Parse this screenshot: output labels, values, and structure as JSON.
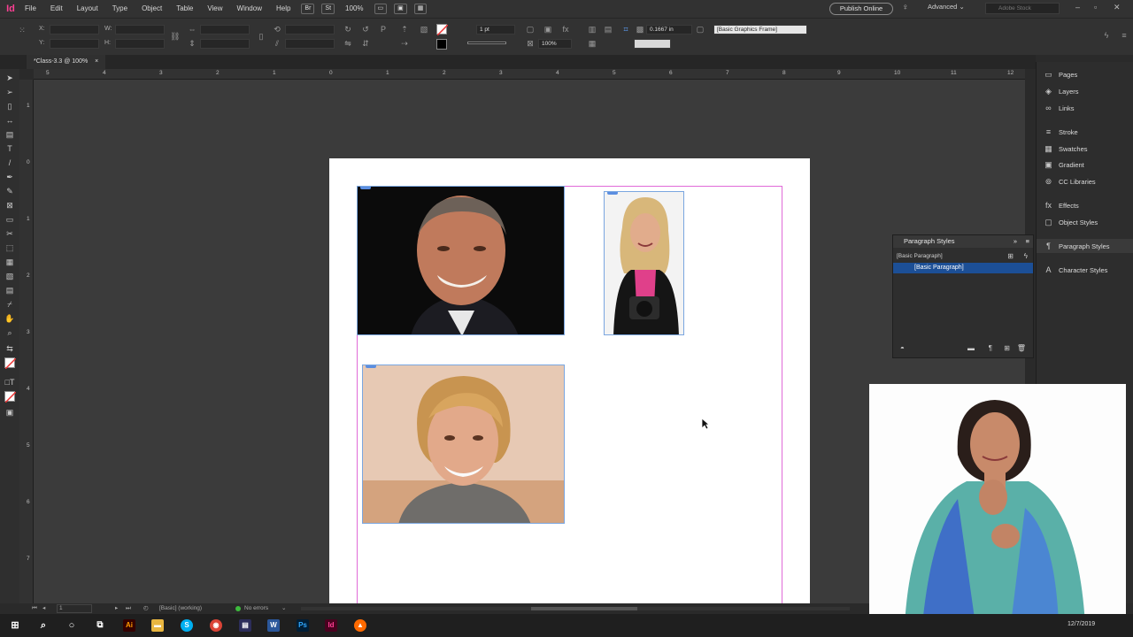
{
  "app": {
    "logo": "Id",
    "menu": [
      "File",
      "Edit",
      "Layout",
      "Type",
      "Object",
      "Table",
      "View",
      "Window",
      "Help"
    ],
    "zoom": "100%",
    "publish_label": "Publish Online",
    "workspace": "Advanced",
    "search_placeholder": "Adobe Stock"
  },
  "control": {
    "x_label": "X:",
    "y_label": "Y:",
    "w_label": "W:",
    "h_label": "H:",
    "stroke_weight": "1 pt",
    "opacity": "100%",
    "offset_value": "0.1667 in",
    "object_style": "[Basic Graphics Frame]"
  },
  "document": {
    "tab_title": "*Class-3.3 @ 100%",
    "ruler_h": [
      "5",
      "4",
      "3",
      "2",
      "1",
      "0",
      "1",
      "2",
      "3",
      "4",
      "5",
      "6",
      "7",
      "8",
      "9",
      "10",
      "11",
      "12"
    ],
    "ruler_v": [
      "1",
      "0",
      "1",
      "2",
      "3",
      "4",
      "5",
      "6",
      "7"
    ]
  },
  "status": {
    "page": "1",
    "style_state": "[Basic] (working)",
    "preflight": "No errors"
  },
  "panels": {
    "strip": [
      {
        "label": "Pages",
        "icon": "pages-icon"
      },
      {
        "label": "Layers",
        "icon": "layers-icon"
      },
      {
        "label": "Links",
        "icon": "links-icon"
      },
      {
        "label": "Stroke",
        "icon": "stroke-icon"
      },
      {
        "label": "Swatches",
        "icon": "swatches-icon"
      },
      {
        "label": "Gradient",
        "icon": "gradient-icon"
      },
      {
        "label": "CC Libraries",
        "icon": "cc-libraries-icon"
      },
      {
        "label": "Effects",
        "icon": "effects-icon"
      },
      {
        "label": "Object Styles",
        "icon": "object-styles-icon"
      },
      {
        "label": "Paragraph Styles",
        "icon": "paragraph-styles-icon"
      },
      {
        "label": "Character Styles",
        "icon": "character-styles-icon"
      }
    ],
    "paragraph_styles": {
      "title": "Paragraph Styles",
      "current": "[Basic Paragraph]",
      "selected_item": "[Basic Paragraph]"
    }
  },
  "taskbar": {
    "date": "12/7/2019"
  },
  "colors": {
    "accent": "#1c4f96",
    "margin_guide": "#e06ad8",
    "frame_edge": "#7aa6e0",
    "indesign": "#ff3f94"
  }
}
